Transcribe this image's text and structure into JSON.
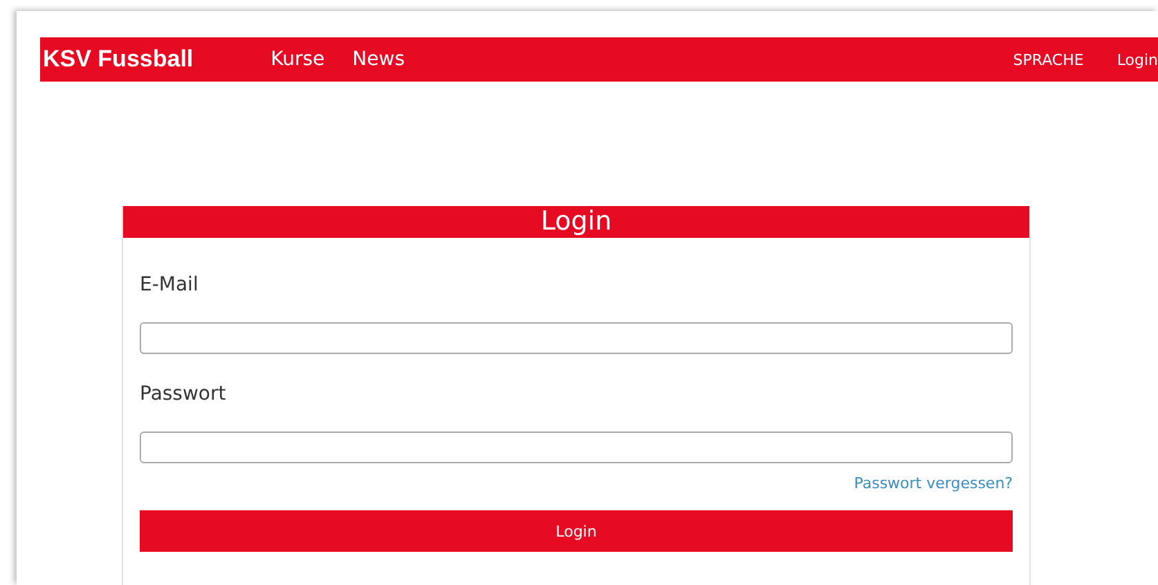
{
  "navbar": {
    "brand": "KSV Fussball",
    "links": [
      "Kurse",
      "News"
    ],
    "right_links": [
      "SPRACHE",
      "Login"
    ]
  },
  "login_card": {
    "title": "Login",
    "fields": [
      {
        "label": "E-Mail"
      },
      {
        "label": "Passwort"
      }
    ],
    "forgot_link": "Passwort vergessen?",
    "submit": "Login"
  }
}
